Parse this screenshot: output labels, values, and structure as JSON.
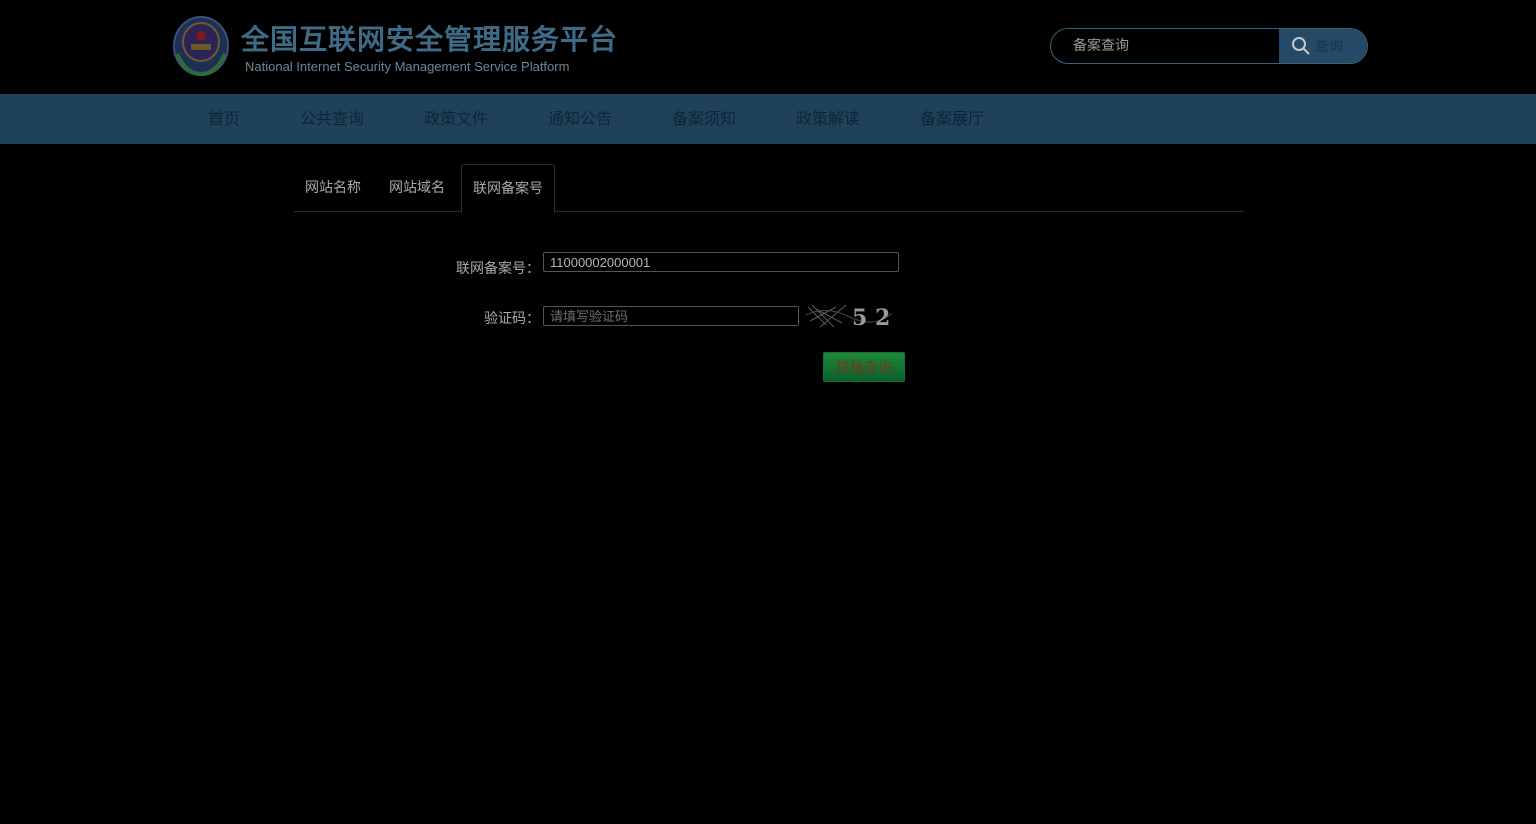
{
  "header": {
    "title": "全国互联网安全管理服务平台",
    "subtitle": "National Internet Security Management Service Platform",
    "search": {
      "placeholder": "备案查询",
      "button_label": "查询"
    }
  },
  "nav": {
    "items": [
      {
        "label": "首页"
      },
      {
        "label": "公共查询"
      },
      {
        "label": "政策文件"
      },
      {
        "label": "通知公告"
      },
      {
        "label": "备案须知"
      },
      {
        "label": "政策解读"
      },
      {
        "label": "备案展厅"
      }
    ]
  },
  "tabs": [
    {
      "label": "网站名称",
      "active": false
    },
    {
      "label": "网站域名",
      "active": false
    },
    {
      "label": "联网备案号",
      "active": true
    }
  ],
  "form": {
    "record_label": "联网备案号：",
    "record_value": "11000002000001",
    "captcha_label": "验证码：",
    "captcha_placeholder": "请填写验证码",
    "captcha_text": "5 2",
    "submit_label": "精确查询"
  },
  "colors": {
    "nav_bg": "#1f425a",
    "search_button": "#244a68",
    "submit_button": "#1d8a3b"
  }
}
